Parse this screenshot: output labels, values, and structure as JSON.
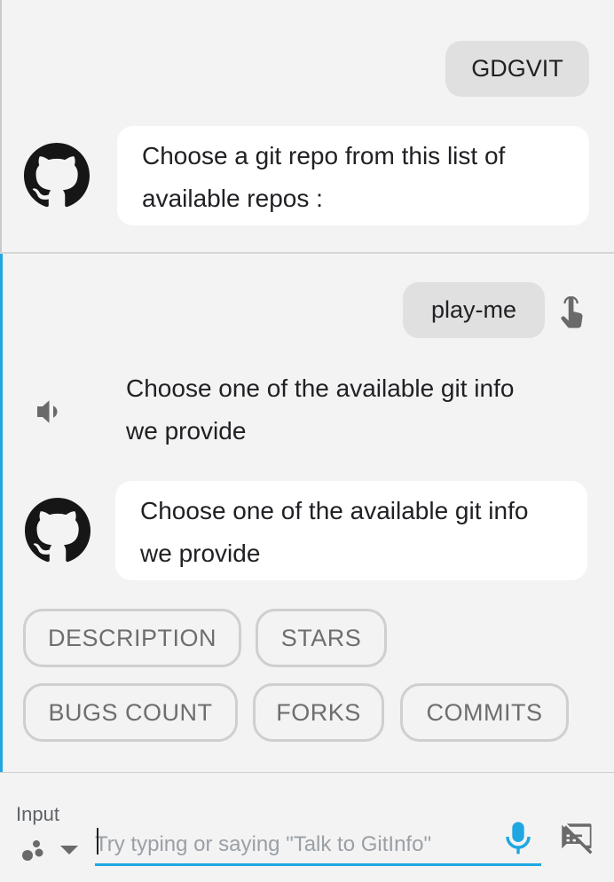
{
  "conversation": {
    "turn1": {
      "user_query": "GDGVIT",
      "bot_reply": "Choose a git repo from this list of available repos :"
    },
    "turn2": {
      "user_query": "play-me",
      "speech_reply": "Choose one of the available git info we provide",
      "bot_reply": "Choose one of the available git info we provide",
      "suggestion_chips": [
        "DESCRIPTION",
        "STARS",
        "BUGS COUNT",
        "FORKS",
        "COMMITS"
      ]
    }
  },
  "input": {
    "label": "Input",
    "placeholder": "Try typing or saying \"Talk to GitInfo\""
  },
  "colors": {
    "accent": "#1ea7e1",
    "user_bubble": "#e0e0e0",
    "bot_bubble": "#ffffff",
    "background": "#f3f3f3"
  },
  "icons": [
    "github-icon",
    "speaker-icon",
    "tap-icon",
    "assistant-dots-icon",
    "dropdown-icon",
    "microphone-icon",
    "feedback-off-icon"
  ]
}
